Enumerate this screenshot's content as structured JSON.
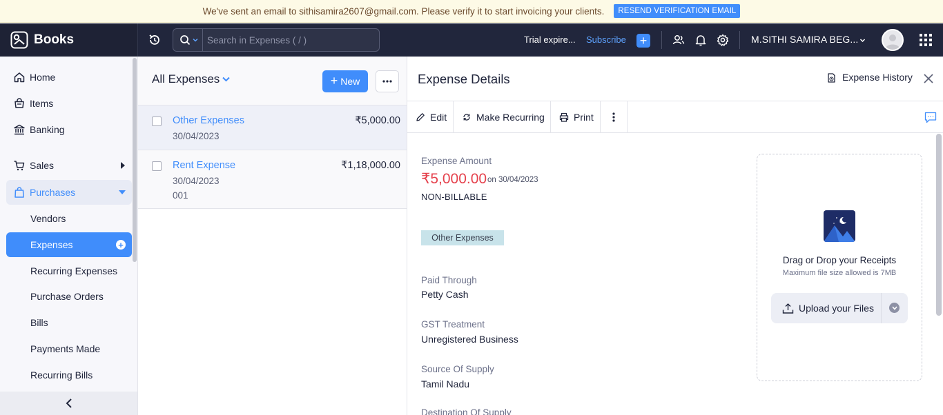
{
  "banner": {
    "text": "We've sent an email to sithisamira2607@gmail.com. Please verify it to start invoicing your clients.",
    "button": "RESEND VERIFICATION EMAIL"
  },
  "topbar": {
    "brand": "Books",
    "search_placeholder": "Search in Expenses ( / )",
    "trial": "Trial expire...",
    "subscribe": "Subscribe",
    "org_name": "M.SITHI SAMIRA BEG..."
  },
  "sidebar": {
    "items": [
      {
        "label": "Home",
        "icon": "home-icon"
      },
      {
        "label": "Items",
        "icon": "items-icon"
      },
      {
        "label": "Banking",
        "icon": "bank-icon"
      },
      {
        "label": "Sales",
        "icon": "cart-icon"
      },
      {
        "label": "Purchases",
        "icon": "bag-icon"
      }
    ],
    "purchase_sub": [
      "Vendors",
      "Expenses",
      "Recurring Expenses",
      "Purchase Orders",
      "Bills",
      "Payments Made",
      "Recurring Bills"
    ]
  },
  "list": {
    "title": "All Expenses",
    "new_label": "New",
    "rows": [
      {
        "name": "Other Expenses",
        "date": "30/04/2023",
        "ref": "",
        "amount": "₹5,000.00"
      },
      {
        "name": "Rent Expense",
        "date": "30/04/2023",
        "ref": "001",
        "amount": "₹1,18,000.00"
      }
    ]
  },
  "details": {
    "title": "Expense Details",
    "history": "Expense History",
    "toolbar": {
      "edit": "Edit",
      "recurring": "Make Recurring",
      "print": "Print"
    },
    "amount_label": "Expense Amount",
    "amount": "₹5,000.00",
    "amount_on": "on 30/04/2023",
    "billable": "NON-BILLABLE",
    "category_tag": "Other Expenses",
    "fields": [
      {
        "label": "Paid Through",
        "value": "Petty Cash"
      },
      {
        "label": "GST Treatment",
        "value": "Unregistered Business"
      },
      {
        "label": "Source Of Supply",
        "value": "Tamil Nadu"
      },
      {
        "label": "Destination Of Supply",
        "value": ""
      }
    ],
    "receipts": {
      "title": "Drag or Drop your Receipts",
      "subtitle": "Maximum file size allowed is 7MB",
      "upload": "Upload your Files"
    }
  },
  "colors": {
    "accent": "#408dfb",
    "topbar": "#21263c",
    "amount": "#e5424d",
    "tag": "#c8e3ea"
  }
}
